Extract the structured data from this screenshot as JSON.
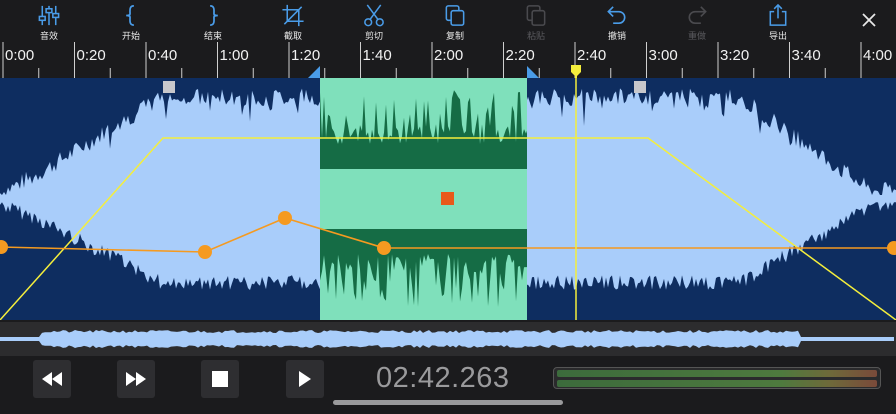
{
  "toolbar": {
    "items": [
      {
        "label": "音效",
        "icon": "sliders-icon",
        "enabled": true
      },
      {
        "label": "开始",
        "icon": "left-brace-icon",
        "enabled": true
      },
      {
        "label": "结束",
        "icon": "right-brace-icon",
        "enabled": true
      },
      {
        "label": "截取",
        "icon": "crop-icon",
        "enabled": true
      },
      {
        "label": "剪切",
        "icon": "scissors-icon",
        "enabled": true
      },
      {
        "label": "复制",
        "icon": "copy-icon",
        "enabled": true
      },
      {
        "label": "粘贴",
        "icon": "paste-icon",
        "enabled": false
      },
      {
        "label": "撤销",
        "icon": "undo-icon",
        "enabled": true
      },
      {
        "label": "重做",
        "icon": "redo-icon",
        "enabled": false
      },
      {
        "label": "导出",
        "icon": "share-icon",
        "enabled": true
      }
    ],
    "close_icon": "close-icon"
  },
  "ruler": {
    "ticks": [
      "0:00",
      "0:20",
      "0:40",
      "1:00",
      "1:20",
      "1:40",
      "2:00",
      "2:20",
      "2:40",
      "3:00",
      "3:20",
      "3:40",
      "4:00"
    ]
  },
  "waveform": {
    "selection_start": "1:22",
    "selection_end": "2:24",
    "playhead": "2:42",
    "colors": {
      "background": "#0e2d60",
      "wave": "#a9cdfa",
      "selection": "#7fe0bb",
      "selection_wave": "#156c45",
      "envelope": "#f4ee3c",
      "volume_line": "#f59a20",
      "center_marker": "#e8591a",
      "playhead": "#f4ee3c",
      "handle": "#4a9ce8"
    }
  },
  "transport": {
    "rewind_icon": "rewind-icon",
    "forward_icon": "fast-forward-icon",
    "stop_icon": "stop-icon",
    "play_icon": "play-icon",
    "time": "02:42.263"
  }
}
